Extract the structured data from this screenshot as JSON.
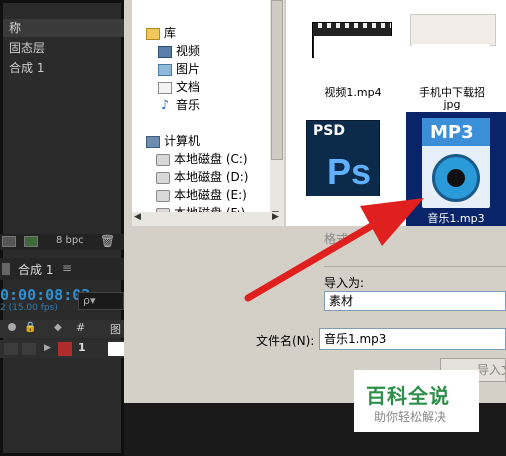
{
  "ae": {
    "title_fragment": "称",
    "items": [
      "固态层",
      "合成 1"
    ],
    "bpc": "8 bpc",
    "comp_tab": "合成 1",
    "comp_tab_suffix": "≡",
    "timecode": "0:00:08:02",
    "fps": "2 (15.00 fps)",
    "search_placeholder": "ρ▾",
    "layer_number": "1",
    "col_hash": "#",
    "col_label": "图"
  },
  "tree": {
    "items": [
      {
        "label": "库",
        "icon": "library-icon"
      },
      {
        "label": "视频",
        "icon": "video-folder-icon"
      },
      {
        "label": "图片",
        "icon": "pictures-folder-icon"
      },
      {
        "label": "文档",
        "icon": "documents-folder-icon"
      },
      {
        "label": "音乐",
        "icon": "music-folder-icon"
      },
      {
        "label": "计算机",
        "icon": "computer-icon"
      },
      {
        "label": "本地磁盘 (C:)",
        "icon": "drive-icon"
      },
      {
        "label": "本地磁盘 (D:)",
        "icon": "drive-icon"
      },
      {
        "label": "本地磁盘 (E:)",
        "icon": "drive-icon"
      },
      {
        "label": "本地磁盘 (F:)",
        "icon": "drive-icon"
      }
    ]
  },
  "files": {
    "top_left_name": "视频1.mp4",
    "top_right_name_line1": "手机中下载招",
    "top_right_name_line2": "jpg",
    "psd_label": "PSD",
    "psd_ps": "Ps",
    "mp3_label": "MP3",
    "selected_name": "音乐1.mp3"
  },
  "form": {
    "format_label": "格式",
    "import_as_label": "导入为:",
    "import_as_value": "素材",
    "filename_label": "文件名(N):",
    "filename_value": "音乐1.mp3",
    "open_button": "导入文件"
  },
  "watermark": {
    "title": "百科全说",
    "subtitle": "助你轻松解决"
  }
}
